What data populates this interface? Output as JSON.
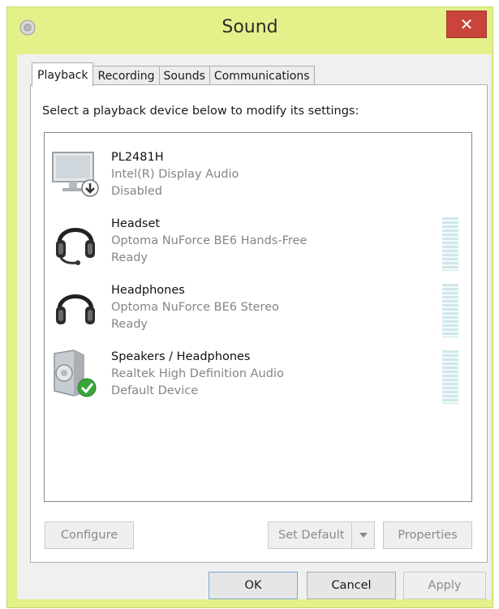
{
  "window": {
    "title": "Sound",
    "close_label": "✕"
  },
  "tabs": [
    {
      "label": "Playback",
      "active": true
    },
    {
      "label": "Recording",
      "active": false
    },
    {
      "label": "Sounds",
      "active": false
    },
    {
      "label": "Communications",
      "active": false
    }
  ],
  "instruction": "Select a playback device below to modify its settings:",
  "devices": [
    {
      "name": "PL2481H",
      "driver": "Intel(R) Display Audio",
      "status": "Disabled",
      "icon": "monitor-icon",
      "has_level_meter": false
    },
    {
      "name": "Headset",
      "driver": "Optoma NuForce BE6 Hands-Free",
      "status": "Ready",
      "icon": "headset-icon",
      "has_level_meter": true
    },
    {
      "name": "Headphones",
      "driver": "Optoma NuForce BE6 Stereo",
      "status": "Ready",
      "icon": "headphones-icon",
      "has_level_meter": true
    },
    {
      "name": "Speakers / Headphones",
      "driver": "Realtek High Definition Audio",
      "status": "Default Device",
      "icon": "speakers-icon",
      "has_level_meter": true
    }
  ],
  "panel_buttons": {
    "configure": "Configure",
    "set_default": "Set Default",
    "properties": "Properties"
  },
  "dialog_buttons": {
    "ok": "OK",
    "cancel": "Cancel",
    "apply": "Apply"
  },
  "colors": {
    "window_frame": "#e4f08a",
    "close_button": "#c9443a",
    "default_check": "#3aa53a"
  }
}
